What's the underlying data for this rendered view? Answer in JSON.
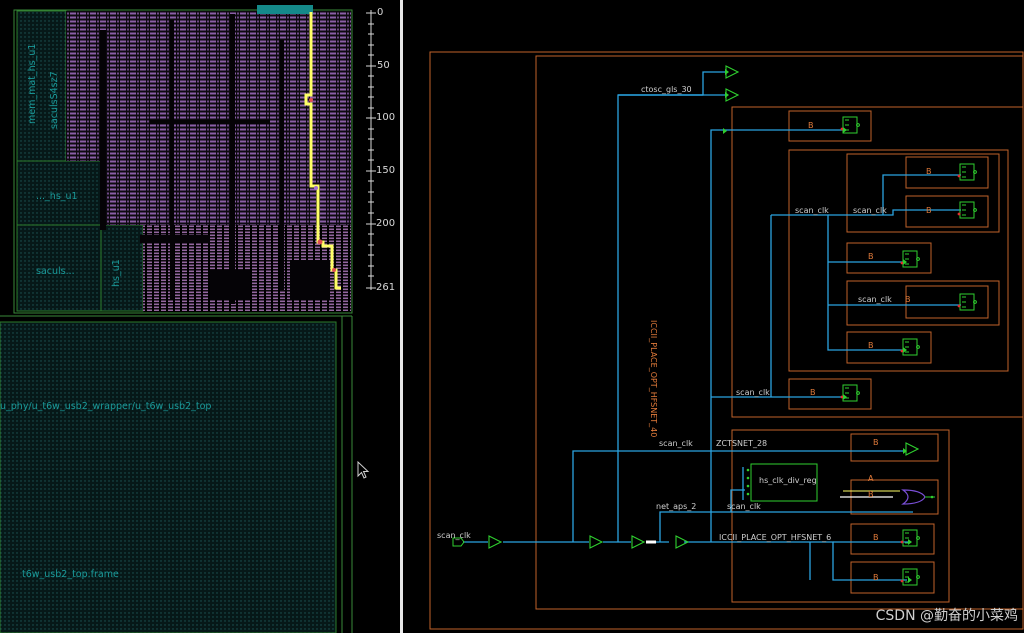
{
  "layout": {
    "blocks": [
      {
        "id": "b1",
        "label": "mem_mat_hs_u1"
      },
      {
        "id": "b2",
        "label": "saculsS4sz7"
      },
      {
        "id": "b3",
        "label": "..._hs_u1"
      },
      {
        "id": "b4",
        "label": "saculs..."
      },
      {
        "id": "b5",
        "label": "hs_u1"
      }
    ],
    "top_label": "u_phy/u_t6w_usb2_wrapper/u_t6w_usb2_top",
    "frame_label": "t6w_usb2_top.frame",
    "ruler": [
      "0",
      "50",
      "100",
      "150",
      "200",
      "261"
    ]
  },
  "schematic": {
    "nets": {
      "ctosc": "ctosc_gls_30",
      "scan_clk": "scan_clk",
      "icc_vert": "ICCII_PLACE_OPT_HFSNET_40",
      "zctsnet": "ZCTSNET_28",
      "net_aps": "net_aps_2",
      "icc_bottom": "ICCII_PLACE_OPT_HFSNET_6"
    },
    "port": "scan_clk",
    "reg": "hs_clk_div_reg",
    "cell_B": "B",
    "cell_A": "A"
  },
  "watermark": "CSDN @勤奋的小菜鸡",
  "colors": {
    "instance": "#c0622a",
    "wire": "#2ba3e0",
    "gate": "#2fcf2f",
    "highlight": "#ffff66",
    "teal": "#1a9a9a",
    "purple": "#8b5fa8"
  }
}
